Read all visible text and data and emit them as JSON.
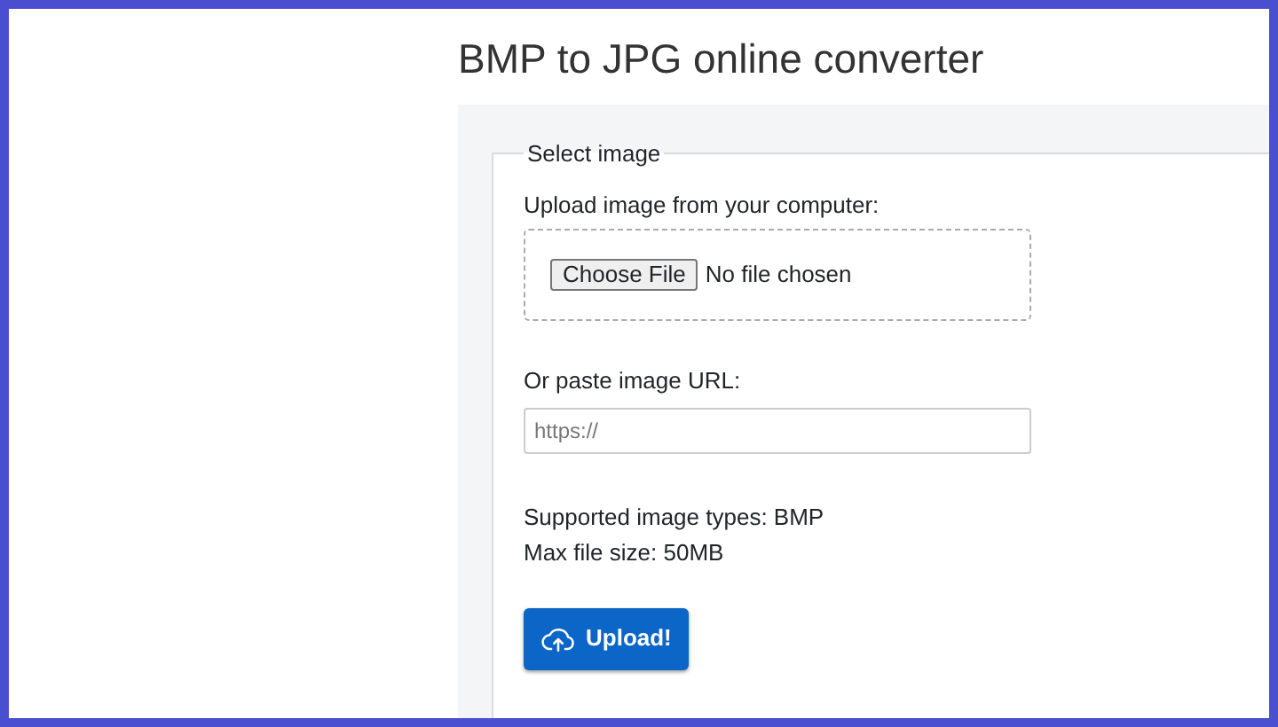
{
  "page": {
    "title": "BMP to JPG online converter"
  },
  "form": {
    "legend": "Select image",
    "file_upload": {
      "label": "Upload image from your computer:",
      "button": "Choose File",
      "status": "No file chosen"
    },
    "url": {
      "label": "Or paste image URL:",
      "placeholder": "https://"
    },
    "info": [
      "Supported image types: BMP",
      "Max file size: 50MB"
    ],
    "submit": "Upload!"
  }
}
